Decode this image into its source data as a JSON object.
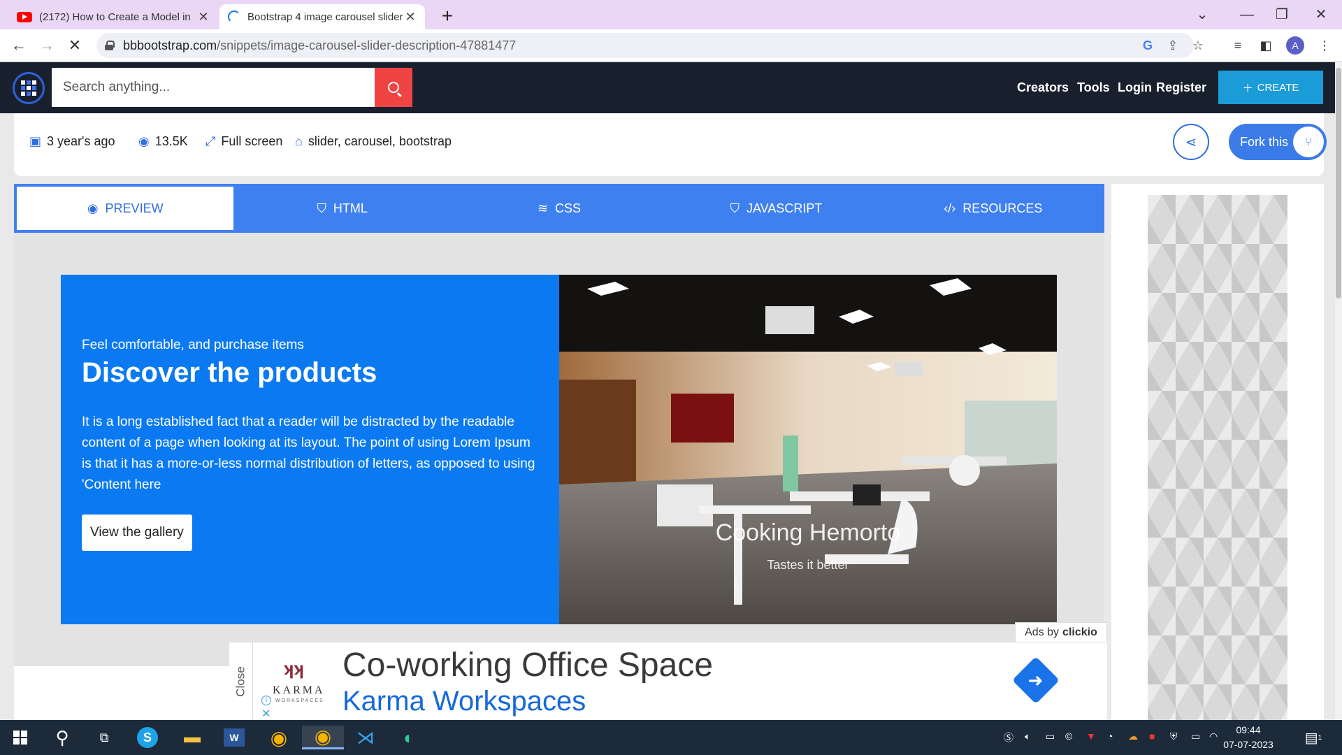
{
  "browser": {
    "tabs": [
      {
        "title": "(2172) How to Create a Model in",
        "active": false
      },
      {
        "title": "Bootstrap 4 image carousel slider",
        "active": true
      }
    ],
    "new_tab": "+",
    "url_host": "bbbootstrap.com",
    "url_path": "/snippets/image-carousel-slider-description-47881477",
    "profile_initial": "A"
  },
  "site": {
    "search_placeholder": "Search anything...",
    "nav": [
      "Creators",
      "Tools",
      "Login",
      "Register"
    ],
    "create_label": "CREATE"
  },
  "meta": {
    "date": "3 year's ago",
    "views": "13.5K",
    "fullscreen": "Full screen",
    "tags": "slider, carousel, bootstrap",
    "fork_label": "Fork this"
  },
  "code_tabs": [
    "PREVIEW",
    "HTML",
    "CSS",
    "JAVASCRIPT",
    "RESOURCES"
  ],
  "slide": {
    "subtitle": "Feel comfortable, and purchase items",
    "title": "Discover the products",
    "text": "It is a long established fact that a reader will be distracted by the readable content of a page when looking at its layout. The point of using Lorem Ipsum is that it has a more-or-less normal distribution of letters, as opposed to using 'Content here",
    "button": "View the gallery",
    "caption_title": "Cooking Hemorto",
    "caption_sub": "Tastes it better"
  },
  "ad": {
    "label_prefix": "Ads by",
    "label_brand": "clickio",
    "close": "Close",
    "logo_mark": "ʞʞ",
    "logo_word": "KARMA",
    "logo_sub": "WORKSPACES",
    "headline": "Co-working Office Space",
    "brand": "Karma Workspaces"
  },
  "taskbar": {
    "time": "09:44",
    "date": "07-07-2023",
    "notifications": "1"
  },
  "colors": {
    "header_bg": "#19202d",
    "accent_blue": "#3f80f0",
    "slide_blue": "#0b7af2",
    "search_red": "#f04343",
    "create_blue": "#1b9bd7"
  }
}
